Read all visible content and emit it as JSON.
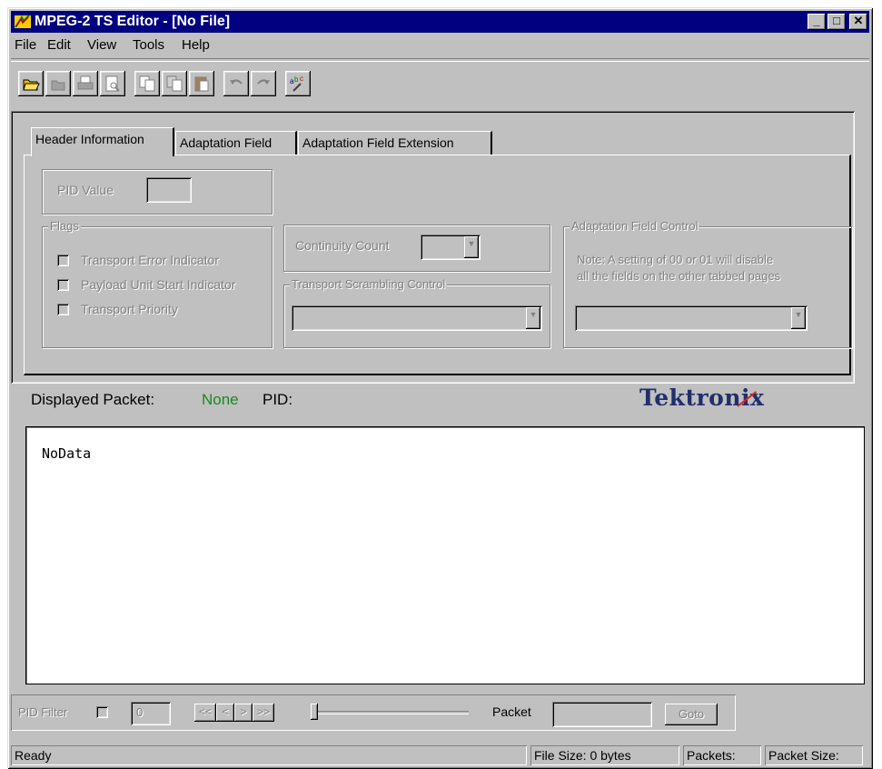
{
  "window": {
    "title": "MPEG-2 TS Editor - [No File]",
    "controls": {
      "minimize": "_",
      "maximize": "□",
      "close": "✕"
    }
  },
  "menu": [
    "File",
    "Edit",
    "View",
    "Tools",
    "Help"
  ],
  "toolbar": {
    "buttons": [
      "open-icon",
      "close-file-icon",
      "print-icon",
      "print-preview-icon",
      "copy-icon",
      "cut-icon",
      "paste-icon",
      "undo-icon",
      "redo-icon",
      "spell-check-icon"
    ]
  },
  "tabs": [
    "Header Information",
    "Adaptation Field",
    "Adaptation Field Extension"
  ],
  "header_info": {
    "pid_value_label": "PID Value",
    "flags_label": "Flags",
    "flags": [
      "Transport Error Indicator",
      "Payload Unit Start Indicator",
      "Transport Priority"
    ],
    "continuity_count_label": "Continuity Count",
    "scrambling_label": "Transport Scrambling Control",
    "adaptation_control_label": "Adaptation Field Control",
    "adaptation_note_line1": "Note: A setting of 00 or 01 will disable",
    "adaptation_note_line2": "all the fields on the other tabbed pages"
  },
  "packet_info": {
    "displayed_packet_label": "Displayed Packet:",
    "displayed_packet_value": "None",
    "pid_label": "PID:"
  },
  "logo": "Tektronix",
  "data_view": {
    "text": "NoData"
  },
  "navigation": {
    "pid_filter_label": "PID Filter",
    "pid_filter_value": "0",
    "nav_buttons": [
      "<<",
      "<",
      ">",
      ">>"
    ],
    "slider_position": 0,
    "packet_label": "Packet",
    "goto_label": "Goto"
  },
  "status": {
    "ready": "Ready",
    "file_size": "File Size: 0 bytes",
    "packets": "Packets:",
    "packet_size": "Packet Size:"
  },
  "colors": {
    "titlebar": "#000080",
    "face": "#c0c0c0",
    "none_value": "#1a8a1a",
    "logo": "#1f2f6e"
  }
}
